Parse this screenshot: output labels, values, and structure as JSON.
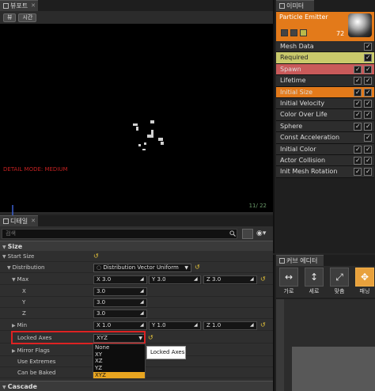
{
  "viewport_panel": {
    "tab_label": "뷰포트",
    "toolbar": {
      "view_btn": "뷰",
      "time_btn": "시간"
    },
    "detail_mode": "DETAIL MODE: MEDIUM",
    "frame_count": "11/ 22"
  },
  "emitters_panel": {
    "tab_label": "이미터",
    "emitter_name": "Particle Emitter",
    "emitter_count": "72",
    "modules": [
      {
        "label": "Mesh Data",
        "color": "#2d2d2d",
        "graph": false
      },
      {
        "label": "Required",
        "color": "#c9c96b",
        "graph": false
      },
      {
        "label": "Spawn",
        "color": "#c95a5a",
        "graph": true
      },
      {
        "label": "Lifetime",
        "color": "#2d2d2d",
        "graph": true
      },
      {
        "label": "Initial Size",
        "color": "#e37a1a",
        "graph": true
      },
      {
        "label": "Initial Velocity",
        "color": "#2d2d2d",
        "graph": true
      },
      {
        "label": "Color Over Life",
        "color": "#2d2d2d",
        "graph": true
      },
      {
        "label": "Sphere",
        "color": "#2d2d2d",
        "graph": true
      },
      {
        "label": "Const Acceleration",
        "color": "#2d2d2d",
        "graph": false
      },
      {
        "label": "Initial Color",
        "color": "#2d2d2d",
        "graph": true
      },
      {
        "label": "Actor Collision",
        "color": "#2d2d2d",
        "graph": true
      },
      {
        "label": "Init Mesh Rotation",
        "color": "#2d2d2d",
        "graph": true
      }
    ]
  },
  "details_panel": {
    "tab_label": "디테일",
    "search_placeholder": "검색",
    "category_size": "Size",
    "category_cascade": "Cascade",
    "rows": {
      "start_size": "Start Size",
      "distribution": "Distribution",
      "distribution_value": "Distribution Vector Uniform",
      "max": "Max",
      "max_x": "X  3.0",
      "max_y": "Y  3.0",
      "max_z": "Z  3.0",
      "x": "X",
      "x_val": "3.0",
      "y": "Y",
      "y_val": "3.0",
      "z": "Z",
      "z_val": "3.0",
      "min": "Min",
      "min_x": "X  1.0",
      "min_y": "Y  1.0",
      "min_z": "Z  1.0",
      "locked_axes": "Locked Axes",
      "locked_axes_value": "XYZ",
      "mirror_flags": "Mirror Flags",
      "use_extremes": "Use Extremes",
      "can_be_baked": "Can be Baked"
    },
    "dropdown_options": [
      "None",
      "XY",
      "XZ",
      "YZ",
      "XYZ"
    ],
    "dropdown_selected": "XYZ",
    "tooltip": "Locked Axes"
  },
  "curve_editor_panel": {
    "tab_label": "커브 에디터",
    "buttons": [
      {
        "label": "가로",
        "icon": "horizontal-fit-icon"
      },
      {
        "label": "세로",
        "icon": "vertical-fit-icon"
      },
      {
        "label": "맞춤",
        "icon": "fit-icon"
      },
      {
        "label": "패닝",
        "icon": "pan-icon"
      }
    ]
  },
  "accent_color": "#e37a1a"
}
